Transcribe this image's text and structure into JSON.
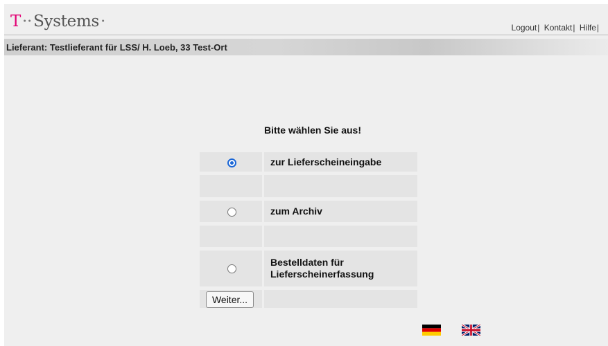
{
  "header": {
    "logo": {
      "t": "T",
      "dots": "··",
      "name": "Systems",
      "tail": "·"
    },
    "links": [
      "Logout",
      "Kontakt",
      "Hilfe"
    ]
  },
  "supplier": {
    "text": "Lieferant: Testlieferant für LSS/ H. Loeb, 33 Test-Ort"
  },
  "main": {
    "title": "Bitte wählen Sie aus!",
    "options": [
      {
        "label": "zur Lieferscheineingabe",
        "checked": true
      },
      {
        "label": "zum Archiv",
        "checked": false
      },
      {
        "label": "Bestelldaten für Lieferscheinerfassung",
        "checked": false
      }
    ],
    "submit_label": "Weiter..."
  },
  "languages": [
    {
      "code": "de",
      "icon": "german-flag-icon"
    },
    {
      "code": "en",
      "icon": "uk-flag-icon"
    }
  ],
  "colors": {
    "brand_magenta": "#e20074",
    "radio_selected": "#1a66d6",
    "cell_bg": "#e4e4e4",
    "page_bg": "#efefef"
  }
}
